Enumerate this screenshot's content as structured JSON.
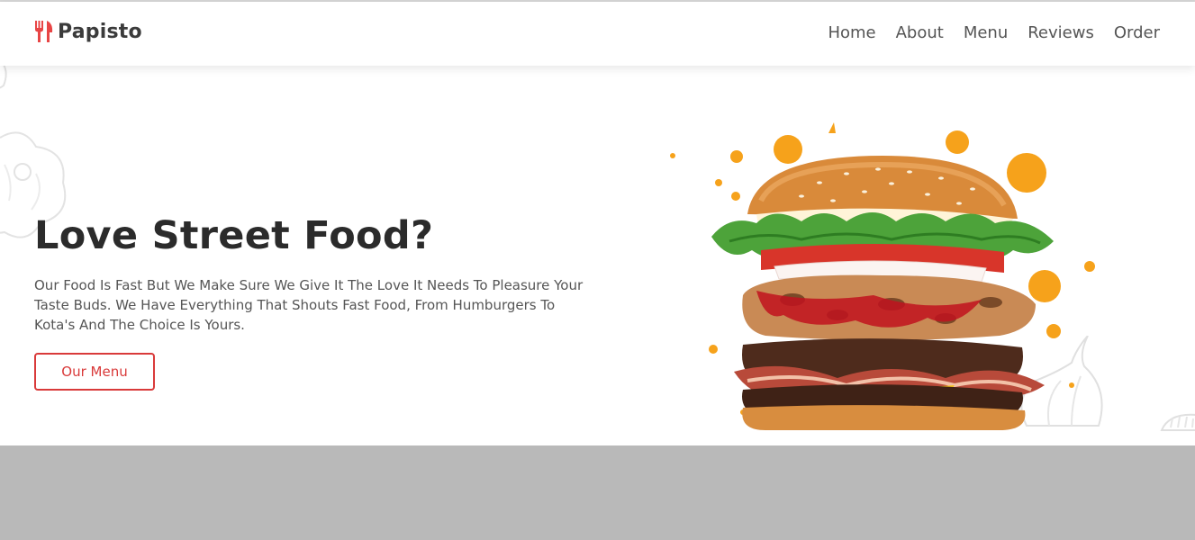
{
  "brand": {
    "name": "Papisto",
    "icon": "utensils-icon",
    "accent": "#e84545"
  },
  "nav": {
    "items": [
      {
        "label": "Home"
      },
      {
        "label": "About"
      },
      {
        "label": "Menu"
      },
      {
        "label": "Reviews"
      },
      {
        "label": "Order"
      }
    ]
  },
  "hero": {
    "title": "Love Street Food?",
    "description": "Our Food Is Fast But We Make Sure We Give It The Love It Needs To Pleasure Your Taste Buds. We Have Everything That Shouts Fast Food, From Humburgers To Kota's And The Choice Is Yours.",
    "cta_label": "Our Menu",
    "image": "burger-image"
  },
  "colors": {
    "accent": "#d93a3a",
    "splash": "#f6a21b",
    "footer": "#b9b9b9"
  }
}
